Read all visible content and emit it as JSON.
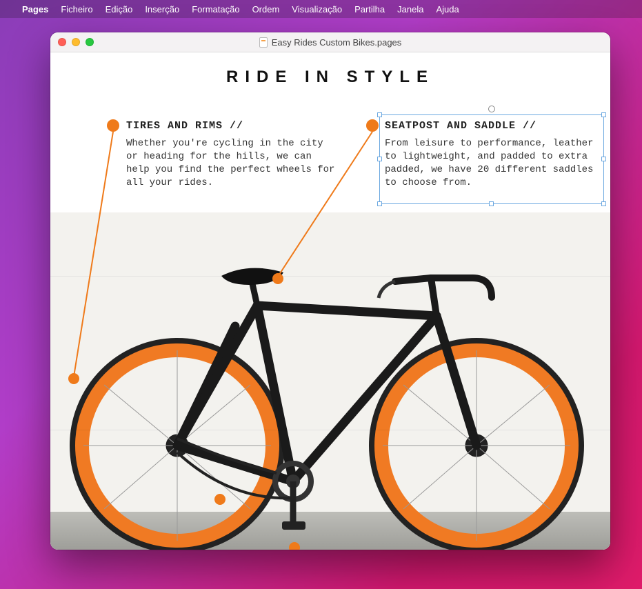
{
  "menubar": {
    "app": "Pages",
    "items": [
      "Ficheiro",
      "Edição",
      "Inserção",
      "Formatação",
      "Ordem",
      "Visualização",
      "Partilha",
      "Janela",
      "Ajuda"
    ]
  },
  "window": {
    "title": "Easy Rides Custom Bikes.pages"
  },
  "document": {
    "headline": "RIDE IN STYLE",
    "blocks": {
      "left": {
        "title": "TIRES AND RIMS //",
        "body": "Whether you're cycling in the city or heading for the hills, we can help you find the perfect wheels for all your rides."
      },
      "right": {
        "title": "SEATPOST AND SADDLE //",
        "body": "From leisure to performance, leather to lightweight, and padded to extra padded, we have 20 different saddles to choose from."
      }
    }
  },
  "colors": {
    "accent": "#ef7a1a",
    "wheel_rim": "#f07a23",
    "frame": "#1a1a1a",
    "selection": "#6aa7e0"
  }
}
